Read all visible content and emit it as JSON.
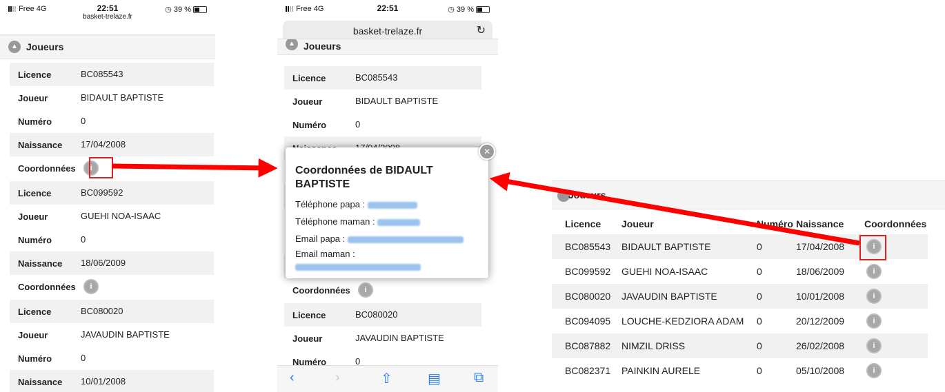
{
  "status": {
    "carrier": "Free 4G",
    "time": "22:51",
    "site": "basket-trelaze.fr",
    "battery": "39 %"
  },
  "labels": {
    "licence": "Licence",
    "joueur": "Joueur",
    "numero": "Numéro",
    "naissance": "Naissance",
    "coordonnees": "Coordonnées"
  },
  "section": {
    "title": "Joueurs"
  },
  "players": [
    {
      "licence": "BC085543",
      "joueur": "BIDAULT BAPTISTE",
      "numero": "0",
      "naissance": "17/04/2008"
    },
    {
      "licence": "BC099592",
      "joueur": "GUEHI NOA-ISAAC",
      "numero": "0",
      "naissance": "18/06/2009"
    },
    {
      "licence": "BC080020",
      "joueur": "JAVAUDIN BAPTISTE",
      "numero": "0",
      "naissance": "10/01/2008"
    },
    {
      "licence": "BC094095",
      "joueur": "LOUCHE-KEDZIORA ADAM",
      "numero": "0",
      "naissance": "20/12/2009"
    },
    {
      "licence": "BC087882",
      "joueur": "NIMZIL DRISS",
      "numero": "0",
      "naissance": "26/02/2008"
    },
    {
      "licence": "BC082371",
      "joueur": "PAINKIN AURELE",
      "numero": "0",
      "naissance": "05/10/2008"
    }
  ],
  "browser": {
    "url": "basket-trelaze.fr",
    "reload_icon": "reload-icon",
    "nav_icons": [
      "back-icon",
      "forward-icon",
      "share-icon",
      "bookmarks-icon",
      "tabs-icon"
    ]
  },
  "popup": {
    "title": "Coordonnées de BIDAULT BAPTISTE",
    "tel_papa_label": "Téléphone papa :",
    "tel_maman_label": "Téléphone maman :",
    "email_papa_label": "Email papa :",
    "email_maman_label": "Email maman :"
  },
  "table": {
    "headers": [
      "Licence",
      "Joueur",
      "Numéro",
      "Naissance",
      "Coordonnées"
    ]
  },
  "colors": {
    "highlight": "#e02020",
    "arrow": "#ff0000",
    "link": "#2b7cf6"
  }
}
